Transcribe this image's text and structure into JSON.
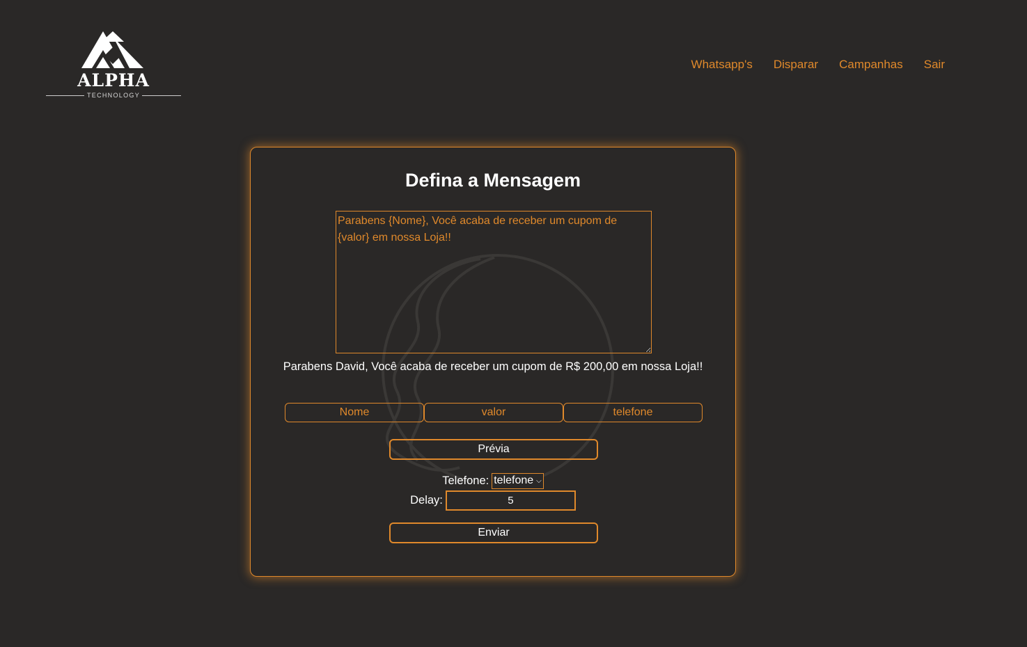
{
  "header": {
    "logo_word": "ALPHA",
    "logo_sub": "TECHNOLOGY",
    "nav": [
      "Whatsapp's",
      "Disparar",
      "Campanhas",
      "Sair"
    ]
  },
  "card": {
    "title": "Defina a Mensagem",
    "message_value": "Parabens {Nome}, Você acaba de receber um cupom de {valor} em nossa Loja!!",
    "preview_text": "Parabens David, Você acaba de receber um cupom de R$ 200,00 em nossa Loja!!",
    "variables": [
      "Nome",
      "valor",
      "telefone"
    ],
    "preview_button": "Prévia",
    "phone_label": "Telefone:",
    "phone_select_value": "telefone",
    "delay_label": "Delay:",
    "delay_value": "5",
    "send_button": "Enviar"
  },
  "colors": {
    "background": "#2a2827",
    "accent": "#e0892b",
    "text": "#ffffff"
  }
}
